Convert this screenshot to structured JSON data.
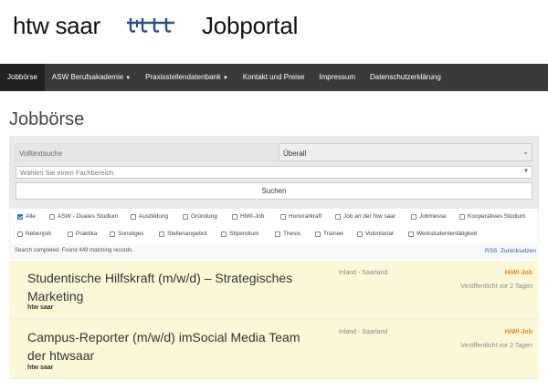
{
  "header": {
    "brand": "htw saar",
    "logo_icon": "htw-wave-logo-icon",
    "portal_title": "Jobportal"
  },
  "nav": {
    "items": [
      {
        "label": "Jobbörse",
        "active": true
      },
      {
        "label": "ASW Berufsakademie",
        "dropdown": true
      },
      {
        "label": "Praxisstellendatenbank",
        "dropdown": true
      },
      {
        "label": "Kontakt und Preise"
      },
      {
        "label": "Impressum"
      },
      {
        "label": "Datenschutzerklärung"
      }
    ]
  },
  "page": {
    "title": "Jobbörse"
  },
  "search": {
    "fulltext_placeholder": "Volltextsuche",
    "region_value": "Überall",
    "field_placeholder": "Wählen Sie einen Fachbereich",
    "button_label": "Suchen"
  },
  "filters": {
    "row1": [
      {
        "label": "Alle",
        "checked": true
      },
      {
        "label": "ASW - Duales Studium",
        "checked": false
      },
      {
        "label": "Ausbildung",
        "checked": false
      },
      {
        "label": "Gründung",
        "checked": false
      },
      {
        "label": "HiWi-Job",
        "checked": false
      },
      {
        "label": "Honorarkraft",
        "checked": false
      },
      {
        "label": "Job an der htw saar",
        "checked": false
      },
      {
        "label": "Jobmesse",
        "checked": false
      },
      {
        "label": "Kooperatives Studium",
        "checked": false
      }
    ],
    "row2": [
      {
        "label": "Nebenjob",
        "checked": false
      },
      {
        "label": "Praktika",
        "checked": false
      },
      {
        "label": "Sonstiges",
        "checked": false
      },
      {
        "label": "Stellenangebot",
        "checked": false
      },
      {
        "label": "Stipendium",
        "checked": false
      },
      {
        "label": "Thesis",
        "checked": false
      },
      {
        "label": "Trainee",
        "checked": false
      },
      {
        "label": "Volontariat",
        "checked": false
      },
      {
        "label": "Werkstudententätigkeit",
        "checked": false
      }
    ]
  },
  "status": {
    "text": "Search completed. Found 449 matching records.",
    "rss": "RSS",
    "reset": "Zurücksetzen"
  },
  "jobs": [
    {
      "title": "Studentische Hilfskraft (m/w/d) – Strategisches Marketing",
      "company": "htw saar",
      "location": "Inland - Saarland",
      "type": "HiWi-Job",
      "date": "Veröffentlicht vor 2 Tagen"
    },
    {
      "title": "Campus-Reporter (m/w/d) imSocial Media Team der htwsaar",
      "company": "htw saar",
      "location": "Inland - Saarland",
      "type": "HiWi-Job",
      "date": "Veröffentlicht vor 2 Tagen"
    }
  ],
  "colors": {
    "nav_bg": "#3a3a3a",
    "brand_blue": "#2a4f8a",
    "job_bg": "#fbf8d8",
    "job_type": "#e08a1e",
    "checkbox_checked": "#2a73d6"
  }
}
